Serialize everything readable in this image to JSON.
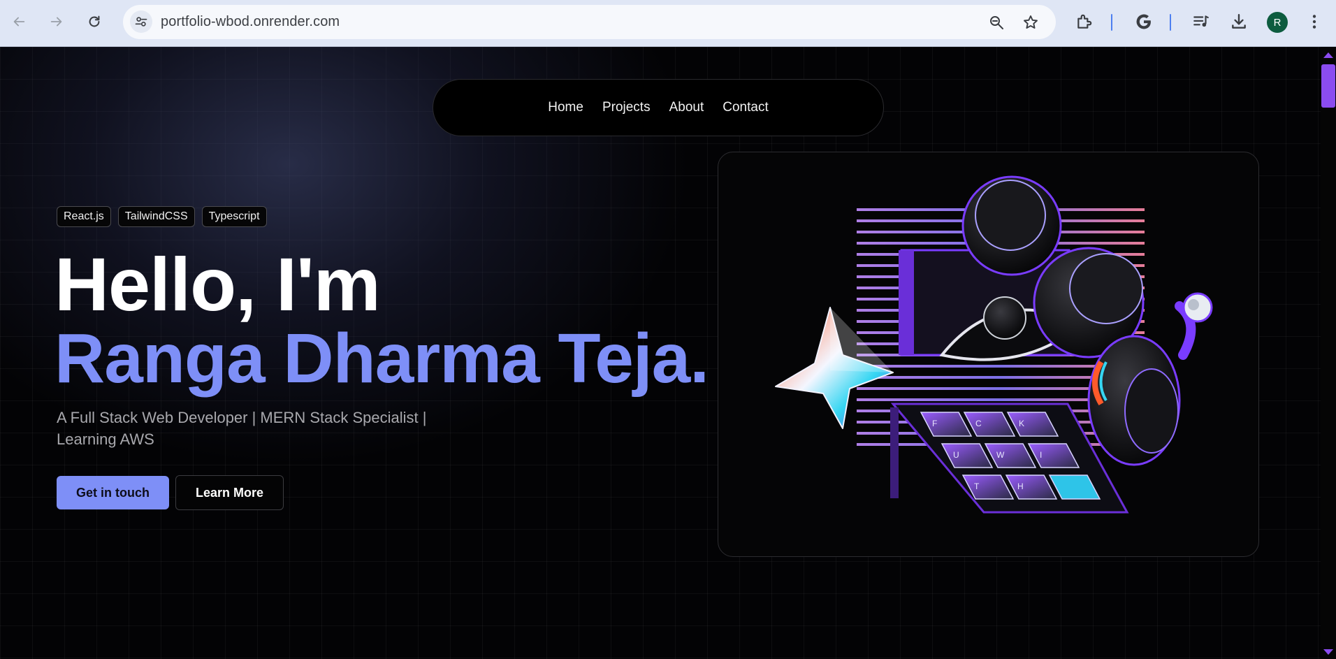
{
  "browser": {
    "url": "portfolio-wbod.onrender.com",
    "profile_initial": "R",
    "icons": [
      "back-icon",
      "forward-icon",
      "reload-icon",
      "site-settings-icon",
      "zoom-icon",
      "bookmark-star-icon",
      "extensions-icon",
      "google-icon",
      "media-controls-icon",
      "downloads-icon",
      "menu-icon"
    ]
  },
  "nav": {
    "items": [
      "Home",
      "Projects",
      "About",
      "Contact"
    ]
  },
  "hero": {
    "tags": [
      "React.js",
      "TailwindCSS",
      "Typescript"
    ],
    "greeting": "Hello, I'm",
    "name": "Ranga Dharma Teja.",
    "tagline": "A Full Stack Web Developer | MERN Stack Specialist | Learning AWS",
    "primary_button": "Get in touch",
    "secondary_button": "Learn More"
  },
  "illustration": {
    "keyboard_keys": [
      "F",
      "C",
      "K",
      "U",
      "W",
      "I",
      "T",
      "H"
    ]
  },
  "colors": {
    "accent": "#7e8ff7",
    "background": "#030305",
    "scrollbar": "#8b4cf0"
  }
}
